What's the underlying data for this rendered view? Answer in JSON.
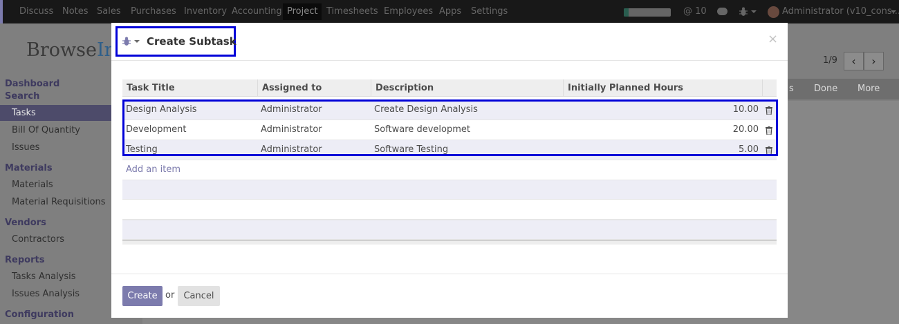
{
  "topnav": {
    "items": [
      "Discuss",
      "Notes",
      "Sales",
      "Purchases",
      "Inventory",
      "Accounting",
      "Project",
      "Timesheets",
      "Employees",
      "Apps",
      "Settings"
    ],
    "active": "Project",
    "mentions": "@ 10",
    "user": "Administrator (v10_cons...",
    "progress": 0.1
  },
  "background": {
    "logo_main": "Browse",
    "logo_accent": "Inf",
    "sidebar": {
      "dashboard": "Dashboard",
      "search": "Search",
      "tasks": "Tasks",
      "bill_of_quantity": "Bill Of Quantity",
      "issues": "Issues",
      "materials_head": "Materials",
      "materials": "Materials",
      "material_requisitions": "Material Requisitions",
      "vendors_head": "Vendors",
      "contractors": "Contractors",
      "reports_head": "Reports",
      "tasks_analysis": "Tasks Analysis",
      "issues_analysis": "Issues Analysis",
      "configuration_head": "Configuration"
    },
    "pager": "1/9",
    "stages": {
      "partial": "s",
      "done": "Done",
      "more": "More"
    }
  },
  "modal": {
    "title": "Create Subtask",
    "close": "×",
    "columns": [
      "Task Title",
      "Assigned to",
      "Description",
      "Initially Planned Hours"
    ],
    "rows": [
      {
        "title": "Design Analysis",
        "assigned": "Administrator",
        "description": "Create Design Analysis",
        "hours": "10.00"
      },
      {
        "title": "Development",
        "assigned": "Administrator",
        "description": "Software developmet",
        "hours": "20.00"
      },
      {
        "title": "Testing",
        "assigned": "Administrator",
        "description": "Software Testing",
        "hours": "5.00"
      }
    ],
    "add_item": "Add an item",
    "create_label": "Create",
    "or_label": "or",
    "cancel_label": "Cancel"
  },
  "colors": {
    "brand": "#7c7bad",
    "highlight": "#0000d8",
    "navbar": "#252525"
  },
  "icons": [
    "bug-icon",
    "caret-down-icon",
    "close-icon",
    "trash-icon",
    "chevron-left-icon",
    "chevron-right-icon",
    "chat-icon",
    "avatar"
  ]
}
